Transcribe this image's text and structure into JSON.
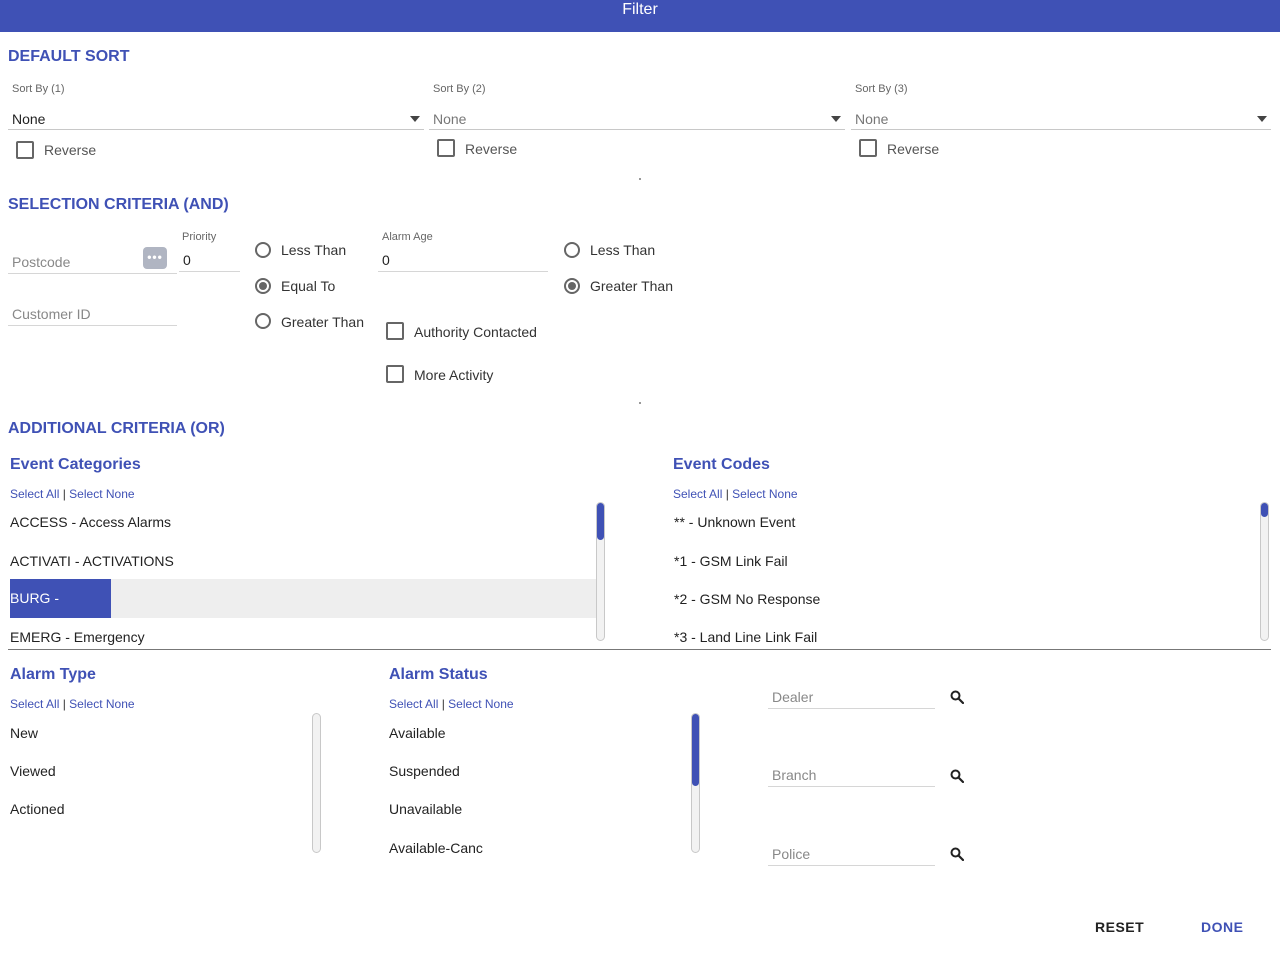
{
  "window": {
    "title": "Filter"
  },
  "default_sort": {
    "title": "DEFAULT SORT",
    "sorts": [
      {
        "label": "Sort By (1)",
        "value": "None",
        "reverse_label": "Reverse"
      },
      {
        "label": "Sort By (2)",
        "value": "None",
        "reverse_label": "Reverse"
      },
      {
        "label": "Sort By (3)",
        "value": "None",
        "reverse_label": "Reverse"
      }
    ]
  },
  "selection_criteria": {
    "title": "SELECTION CRITERIA (AND)",
    "postcode_placeholder": "Postcode",
    "postcode_button": "•••",
    "customer_id_placeholder": "Customer ID",
    "priority": {
      "label": "Priority",
      "value": "0",
      "options": [
        "Less Than",
        "Equal To",
        "Greater Than"
      ],
      "selected": "Equal To"
    },
    "alarm_age": {
      "label": "Alarm Age",
      "value": "0",
      "options": [
        "Less Than",
        "Greater Than"
      ],
      "selected": "Greater Than"
    },
    "authority_contacted_label": "Authority Contacted",
    "more_activity_label": "More Activity"
  },
  "additional_criteria": {
    "title": "ADDITIONAL CRITERIA (OR)",
    "select_all": "Select All",
    "select_none": "Select None",
    "separator": "|",
    "event_categories": {
      "title": "Event Categories",
      "items": [
        "ACCESS - Access Alarms",
        "ACTIVATI - ACTIVATIONS",
        "BURG - Burglary",
        "EMERG - Emergency"
      ],
      "selected": "BURG - Burglary"
    },
    "event_codes": {
      "title": "Event Codes",
      "items": [
        "** - Unknown Event",
        "*1 - GSM Link Fail",
        "*2 - GSM No Response",
        "*3 - Land Line Link Fail"
      ]
    },
    "alarm_type": {
      "title": "Alarm Type",
      "items": [
        "New",
        "Viewed",
        "Actioned"
      ]
    },
    "alarm_status": {
      "title": "Alarm Status",
      "items": [
        "Available",
        "Suspended",
        "Unavailable",
        "Available-Canc"
      ]
    },
    "lookups": {
      "dealer_placeholder": "Dealer",
      "branch_placeholder": "Branch",
      "police_placeholder": "Police"
    }
  },
  "actions": {
    "reset_label": "RESET",
    "done_label": "DONE"
  },
  "colors": {
    "accent": "#3f51b5",
    "selected_row": "#eeeeee"
  },
  "icons": {
    "sort_caret": "caret-down-icon",
    "lookup": "search-icon"
  }
}
